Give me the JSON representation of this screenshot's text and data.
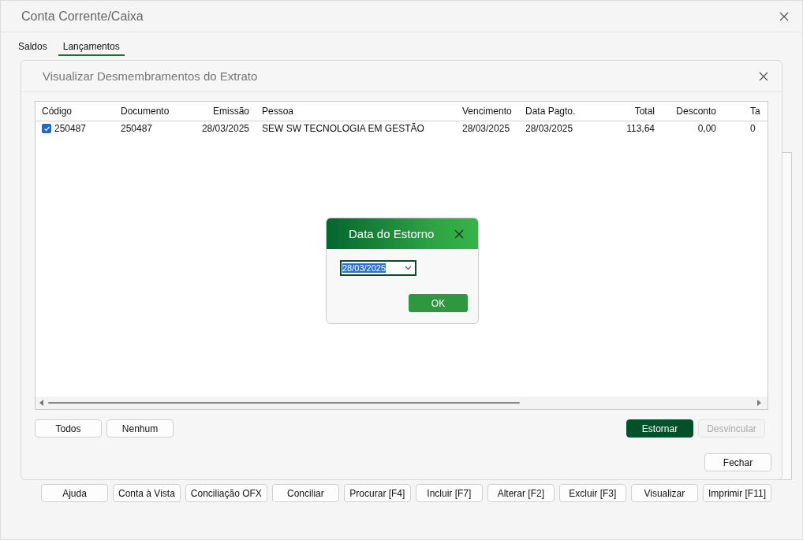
{
  "window": {
    "title": "Conta Corrente/Caixa"
  },
  "tabs": [
    {
      "label": "Saldos",
      "selected": false
    },
    {
      "label": "Lançamentos",
      "selected": true
    }
  ],
  "dialog": {
    "title": "Visualizar Desmembramentos do Extrato",
    "table": {
      "columns": [
        "Código",
        "Documento",
        "Emissão",
        "Pessoa",
        "Vencimento",
        "Data Pagto.",
        "Total",
        "Desconto",
        "Ta"
      ],
      "rows": [
        {
          "checked": true,
          "cells": [
            "250487",
            "250487",
            "28/03/2025",
            "SEW SW TECNOLOGIA EM GESTÃO",
            "28/03/2025",
            "28/03/2025",
            "113,64",
            "0,00",
            "0"
          ]
        }
      ]
    },
    "left_buttons": [
      {
        "label": "Todos",
        "kind": "normal",
        "disabled": false
      },
      {
        "label": "Nenhum",
        "kind": "normal",
        "disabled": false
      }
    ],
    "right_buttons": [
      {
        "label": "Estornar",
        "kind": "primary",
        "disabled": false
      },
      {
        "label": "Desvincular",
        "kind": "normal",
        "disabled": true
      }
    ],
    "close_button": "Fechar"
  },
  "popup": {
    "title": "Data do Estorno",
    "value": "28/03/2025",
    "text_selected": true,
    "ok": "OK"
  },
  "bottom_buttons": [
    "Ajuda",
    "Conta à Vista",
    "Conciliação OFX",
    "Conciliar",
    "Procurar [F4]",
    "Incluir [F7]",
    "Alterar [F2]",
    "Excluir [F3]",
    "Visualizar",
    "Imprimir [F11]"
  ]
}
